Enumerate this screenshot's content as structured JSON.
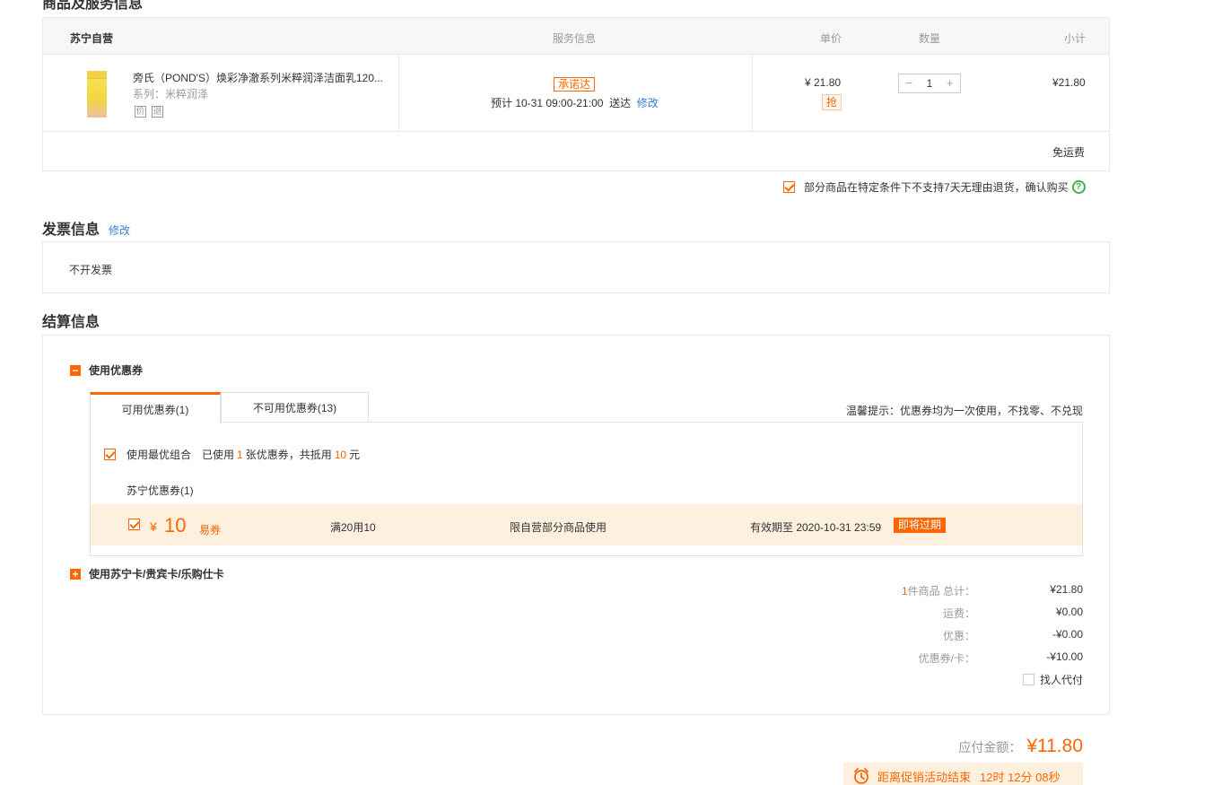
{
  "goods_section": {
    "title": "商品及服务信息",
    "table_header": {
      "store": "苏宁自营",
      "service": "服务信息",
      "price": "单价",
      "qty": "数量",
      "subtotal": "小计"
    },
    "item": {
      "name": "旁氏（POND'S）焕彩净澈系列米粹润泽洁面乳120...",
      "series": "系列：米粹润泽",
      "service_icons": [
        "价",
        "退"
      ],
      "promise_tag": "承诺达",
      "delivery_prefix": "预计 10-31 09:00-21:00",
      "delivery_suffix": "送达",
      "modify_link": "修改",
      "price": "¥ 21.80",
      "qiang_tag": "抢",
      "quantity": "1",
      "minus": "−",
      "plus": "+",
      "subtotal": "¥21.80"
    },
    "free_shipping": "免运费",
    "return_notice": "部分商品在特定条件下不支持7天无理由退货，确认购买",
    "help": "?"
  },
  "invoice_section": {
    "title": "发票信息",
    "modify_link": "修改",
    "content": "不开发票"
  },
  "settlement_section": {
    "title": "结算信息",
    "coupon_toggle": {
      "symbol": "−",
      "label": "使用优惠券"
    },
    "tabs": [
      {
        "label": "可用优惠券(1)"
      },
      {
        "label": "不可用优惠券(13)"
      }
    ],
    "tip": "温馨提示：优惠券均为一次使用，不找零、不兑现",
    "best_combo": {
      "label": "使用最优组合",
      "used_prefix": "已使用",
      "used_count": "1",
      "used_mid": "张优惠券，共抵用",
      "amount": "10",
      "unit": "元"
    },
    "group_label": "苏宁优惠券(1)",
    "coupon": {
      "currency": "¥",
      "value": "10",
      "type": "易券",
      "condition": "满20用10",
      "scope": "限自营部分商品使用",
      "expiry": "有效期至 2020-10-31 23:59",
      "badge": "即将过期"
    },
    "card_toggle": {
      "symbol": "+",
      "label": "使用苏宁卡/贵宾卡/乐购仕卡"
    },
    "summary": {
      "count": "1",
      "count_label": "件商品 总计：",
      "total": "¥21.80",
      "shipping_label": "运费：",
      "shipping": "¥0.00",
      "discount_label": "优惠：",
      "discount": "-¥0.00",
      "coupon_label": "优惠券/卡：",
      "coupon": "-¥10.00",
      "proxy_pay": "找人代付"
    }
  },
  "payment": {
    "label": "应付金额：",
    "amount": "¥11.80",
    "countdown_label": "距离促销活动结束",
    "countdown": "12时 12分 08秒"
  },
  "colors": {
    "accent": "#ff6600",
    "link": "#3a7bd5",
    "coupon_bg": "#fdf0de",
    "help_green": "#3cb34a"
  }
}
